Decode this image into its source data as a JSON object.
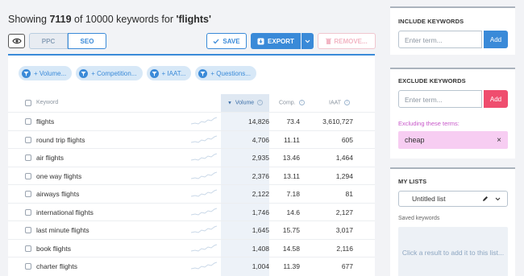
{
  "header": {
    "prefix": "Showing ",
    "count": "7119",
    "middle": " of 10000 keywords for ",
    "query": "'flights'"
  },
  "toolbar": {
    "ppc_label": "PPC",
    "seo_label": "SEO",
    "save_label": "SAVE",
    "export_label": "EXPORT",
    "remove_label": "REMOVE..."
  },
  "filters": [
    "+ Volume...",
    "+ Competition...",
    "+ IAAT...",
    "+ Questions..."
  ],
  "table": {
    "columns": {
      "keyword": "Keyword",
      "volume": "Volume",
      "comp": "Comp.",
      "iaat": "IAAT"
    },
    "rows": [
      {
        "keyword": "flights",
        "volume": "14,826",
        "comp": "73.4",
        "iaat": "3,610,727"
      },
      {
        "keyword": "round trip flights",
        "volume": "4,706",
        "comp": "11.11",
        "iaat": "605"
      },
      {
        "keyword": "air flights",
        "volume": "2,935",
        "comp": "13.46",
        "iaat": "1,464"
      },
      {
        "keyword": "one way flights",
        "volume": "2,376",
        "comp": "13.11",
        "iaat": "1,294"
      },
      {
        "keyword": "airways flights",
        "volume": "2,122",
        "comp": "7.18",
        "iaat": "81"
      },
      {
        "keyword": "international flights",
        "volume": "1,746",
        "comp": "14.6",
        "iaat": "2,127"
      },
      {
        "keyword": "last minute flights",
        "volume": "1,645",
        "comp": "15.75",
        "iaat": "3,017"
      },
      {
        "keyword": "book flights",
        "volume": "1,408",
        "comp": "14.58",
        "iaat": "2,116"
      },
      {
        "keyword": "charter flights",
        "volume": "1,004",
        "comp": "11.39",
        "iaat": "677"
      }
    ]
  },
  "include": {
    "title": "INCLUDE KEYWORDS",
    "placeholder": "Enter term...",
    "add_label": "Add"
  },
  "exclude": {
    "title": "EXCLUDE KEYWORDS",
    "placeholder": "Enter term...",
    "add_label": "Add",
    "excluding_label": "Excluding these terms:",
    "terms": [
      "cheap"
    ]
  },
  "lists": {
    "title": "MY LISTS",
    "selected": "Untitled list",
    "saved_label": "Saved keywords",
    "empty_text": "Click a result to add it to this list..."
  },
  "colors": {
    "accent": "#3a8ad8",
    "danger": "#ef4d6e",
    "exclude_tag": "#f7cdf2"
  }
}
